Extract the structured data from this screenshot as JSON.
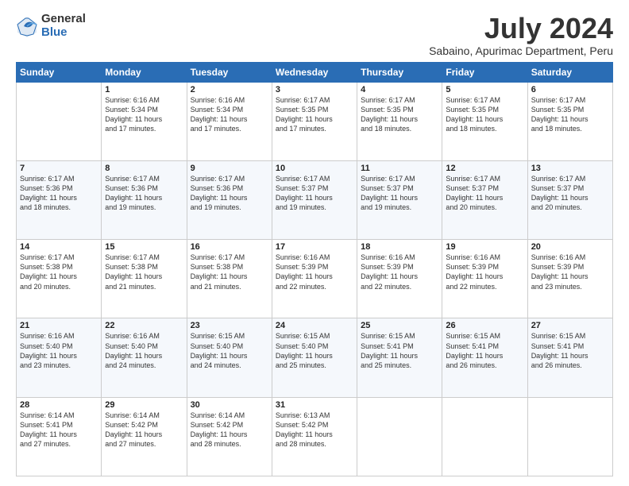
{
  "logo": {
    "general": "General",
    "blue": "Blue"
  },
  "header": {
    "month": "July 2024",
    "location": "Sabaino, Apurimac Department, Peru"
  },
  "weekdays": [
    "Sunday",
    "Monday",
    "Tuesday",
    "Wednesday",
    "Thursday",
    "Friday",
    "Saturday"
  ],
  "weeks": [
    [
      {
        "day": "",
        "content": ""
      },
      {
        "day": "1",
        "content": "Sunrise: 6:16 AM\nSunset: 5:34 PM\nDaylight: 11 hours\nand 17 minutes."
      },
      {
        "day": "2",
        "content": "Sunrise: 6:16 AM\nSunset: 5:34 PM\nDaylight: 11 hours\nand 17 minutes."
      },
      {
        "day": "3",
        "content": "Sunrise: 6:17 AM\nSunset: 5:35 PM\nDaylight: 11 hours\nand 17 minutes."
      },
      {
        "day": "4",
        "content": "Sunrise: 6:17 AM\nSunset: 5:35 PM\nDaylight: 11 hours\nand 18 minutes."
      },
      {
        "day": "5",
        "content": "Sunrise: 6:17 AM\nSunset: 5:35 PM\nDaylight: 11 hours\nand 18 minutes."
      },
      {
        "day": "6",
        "content": "Sunrise: 6:17 AM\nSunset: 5:35 PM\nDaylight: 11 hours\nand 18 minutes."
      }
    ],
    [
      {
        "day": "7",
        "content": "Sunrise: 6:17 AM\nSunset: 5:36 PM\nDaylight: 11 hours\nand 18 minutes."
      },
      {
        "day": "8",
        "content": "Sunrise: 6:17 AM\nSunset: 5:36 PM\nDaylight: 11 hours\nand 19 minutes."
      },
      {
        "day": "9",
        "content": "Sunrise: 6:17 AM\nSunset: 5:36 PM\nDaylight: 11 hours\nand 19 minutes."
      },
      {
        "day": "10",
        "content": "Sunrise: 6:17 AM\nSunset: 5:37 PM\nDaylight: 11 hours\nand 19 minutes."
      },
      {
        "day": "11",
        "content": "Sunrise: 6:17 AM\nSunset: 5:37 PM\nDaylight: 11 hours\nand 19 minutes."
      },
      {
        "day": "12",
        "content": "Sunrise: 6:17 AM\nSunset: 5:37 PM\nDaylight: 11 hours\nand 20 minutes."
      },
      {
        "day": "13",
        "content": "Sunrise: 6:17 AM\nSunset: 5:37 PM\nDaylight: 11 hours\nand 20 minutes."
      }
    ],
    [
      {
        "day": "14",
        "content": "Sunrise: 6:17 AM\nSunset: 5:38 PM\nDaylight: 11 hours\nand 20 minutes."
      },
      {
        "day": "15",
        "content": "Sunrise: 6:17 AM\nSunset: 5:38 PM\nDaylight: 11 hours\nand 21 minutes."
      },
      {
        "day": "16",
        "content": "Sunrise: 6:17 AM\nSunset: 5:38 PM\nDaylight: 11 hours\nand 21 minutes."
      },
      {
        "day": "17",
        "content": "Sunrise: 6:16 AM\nSunset: 5:39 PM\nDaylight: 11 hours\nand 22 minutes."
      },
      {
        "day": "18",
        "content": "Sunrise: 6:16 AM\nSunset: 5:39 PM\nDaylight: 11 hours\nand 22 minutes."
      },
      {
        "day": "19",
        "content": "Sunrise: 6:16 AM\nSunset: 5:39 PM\nDaylight: 11 hours\nand 22 minutes."
      },
      {
        "day": "20",
        "content": "Sunrise: 6:16 AM\nSunset: 5:39 PM\nDaylight: 11 hours\nand 23 minutes."
      }
    ],
    [
      {
        "day": "21",
        "content": "Sunrise: 6:16 AM\nSunset: 5:40 PM\nDaylight: 11 hours\nand 23 minutes."
      },
      {
        "day": "22",
        "content": "Sunrise: 6:16 AM\nSunset: 5:40 PM\nDaylight: 11 hours\nand 24 minutes."
      },
      {
        "day": "23",
        "content": "Sunrise: 6:15 AM\nSunset: 5:40 PM\nDaylight: 11 hours\nand 24 minutes."
      },
      {
        "day": "24",
        "content": "Sunrise: 6:15 AM\nSunset: 5:40 PM\nDaylight: 11 hours\nand 25 minutes."
      },
      {
        "day": "25",
        "content": "Sunrise: 6:15 AM\nSunset: 5:41 PM\nDaylight: 11 hours\nand 25 minutes."
      },
      {
        "day": "26",
        "content": "Sunrise: 6:15 AM\nSunset: 5:41 PM\nDaylight: 11 hours\nand 26 minutes."
      },
      {
        "day": "27",
        "content": "Sunrise: 6:15 AM\nSunset: 5:41 PM\nDaylight: 11 hours\nand 26 minutes."
      }
    ],
    [
      {
        "day": "28",
        "content": "Sunrise: 6:14 AM\nSunset: 5:41 PM\nDaylight: 11 hours\nand 27 minutes."
      },
      {
        "day": "29",
        "content": "Sunrise: 6:14 AM\nSunset: 5:42 PM\nDaylight: 11 hours\nand 27 minutes."
      },
      {
        "day": "30",
        "content": "Sunrise: 6:14 AM\nSunset: 5:42 PM\nDaylight: 11 hours\nand 28 minutes."
      },
      {
        "day": "31",
        "content": "Sunrise: 6:13 AM\nSunset: 5:42 PM\nDaylight: 11 hours\nand 28 minutes."
      },
      {
        "day": "",
        "content": ""
      },
      {
        "day": "",
        "content": ""
      },
      {
        "day": "",
        "content": ""
      }
    ]
  ]
}
